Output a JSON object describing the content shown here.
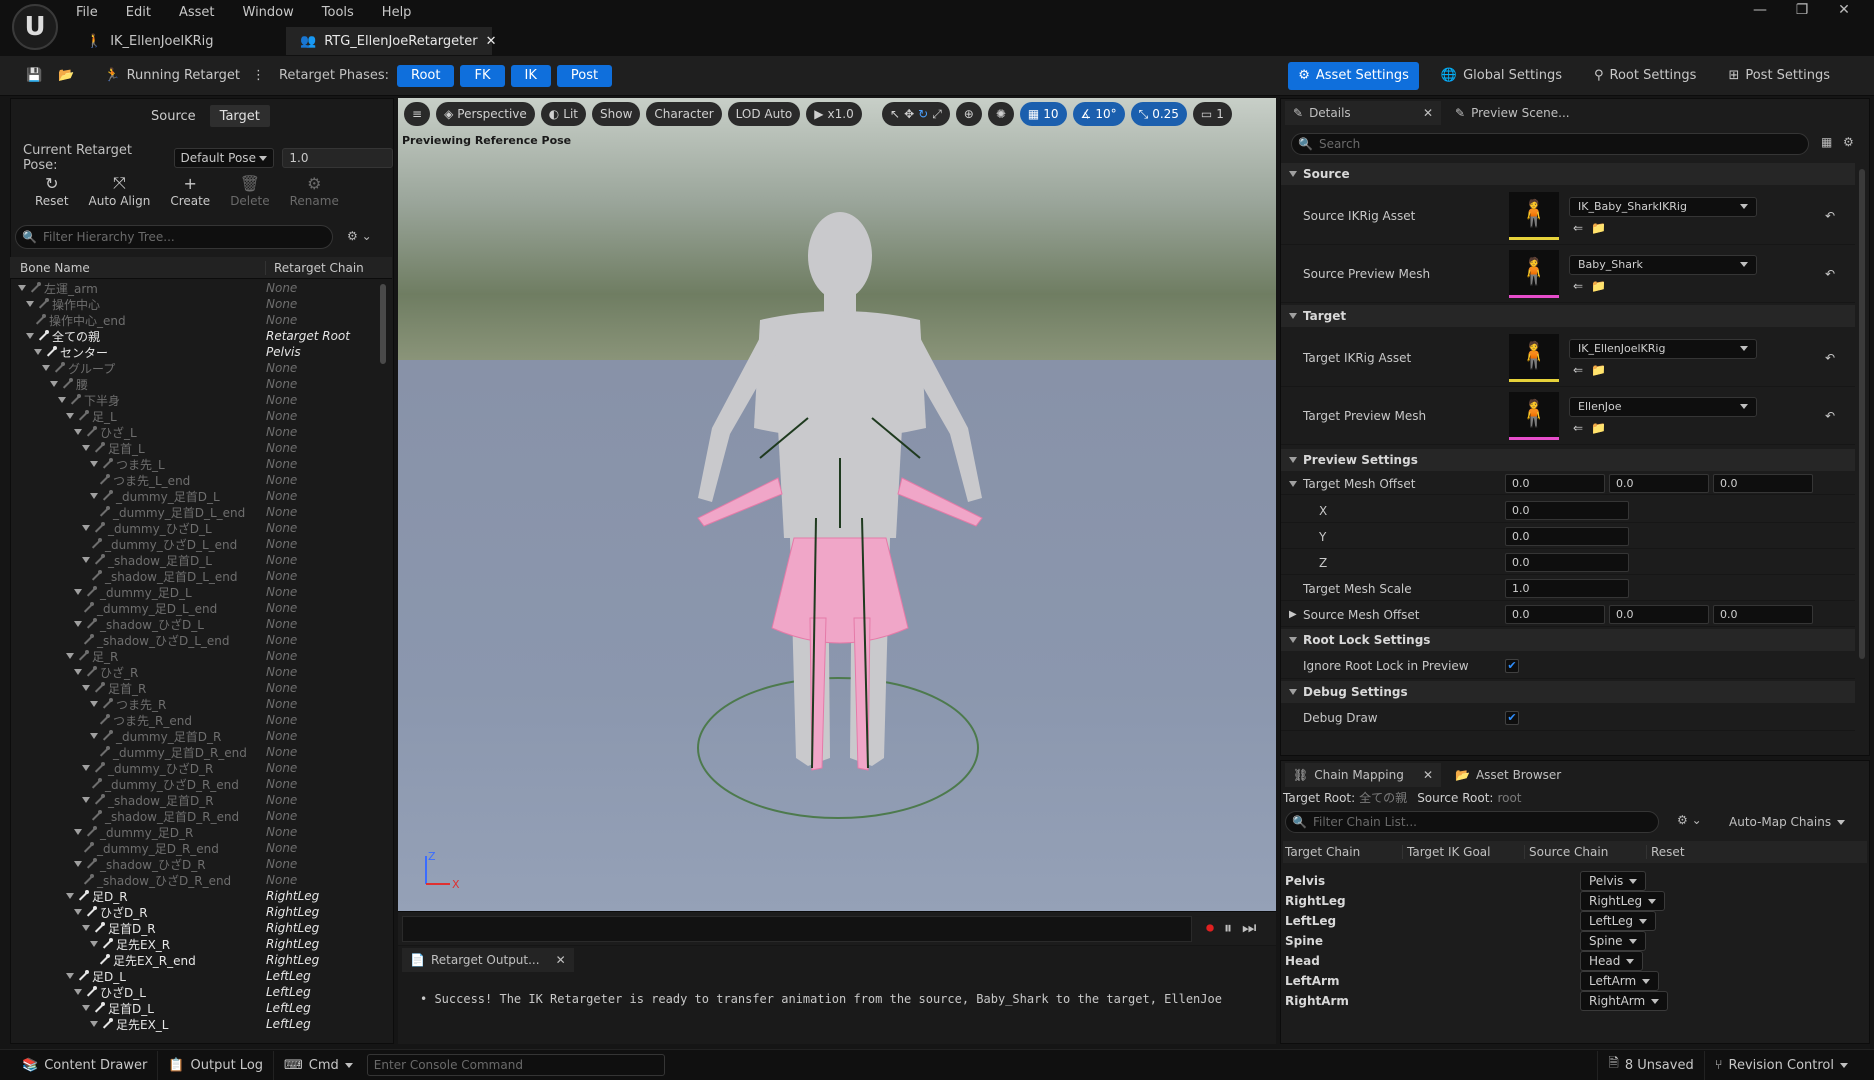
{
  "menu": [
    "File",
    "Edit",
    "Asset",
    "Window",
    "Tools",
    "Help"
  ],
  "tabs": [
    {
      "label": "IK_EllenJoelKRig"
    },
    {
      "label": "RTG_EllenJoeRetargeter"
    }
  ],
  "toolbar": {
    "running": "Running Retarget",
    "phases_label": "Retarget Phases:",
    "phases": [
      "Root",
      "FK",
      "IK",
      "Post"
    ],
    "settings": [
      "Asset Settings",
      "Global Settings",
      "Root Settings",
      "Post Settings"
    ]
  },
  "left": {
    "source": "Source",
    "target": "Target",
    "pose_label": "Current Retarget Pose:",
    "pose_value": "Default Pose",
    "pose_blend": "1.0",
    "actions": [
      "Reset",
      "Auto Align",
      "Create",
      "Delete",
      "Rename"
    ],
    "filter_placeholder": "Filter Hierarchy Tree...",
    "col_bone": "Bone Name",
    "col_chain": "Retarget Chain",
    "bones": [
      {
        "n": "左運_arm",
        "c": "None",
        "d": 0,
        "t": 1,
        "s": "dim"
      },
      {
        "n": "操作中心",
        "c": "None",
        "d": 1,
        "t": 1,
        "s": "dim"
      },
      {
        "n": "操作中心_end",
        "c": "None",
        "d": 2,
        "t": 0,
        "s": "dim"
      },
      {
        "n": "全ての親",
        "c": "Retarget Root",
        "d": 1,
        "t": 1,
        "s": "hi"
      },
      {
        "n": "センター",
        "c": "Pelvis",
        "d": 2,
        "t": 1,
        "s": "hi"
      },
      {
        "n": "グループ",
        "c": "None",
        "d": 3,
        "t": 1,
        "s": "dim"
      },
      {
        "n": "腰",
        "c": "None",
        "d": 4,
        "t": 1,
        "s": "dim"
      },
      {
        "n": "下半身",
        "c": "None",
        "d": 5,
        "t": 1,
        "s": "dim"
      },
      {
        "n": "足_L",
        "c": "None",
        "d": 6,
        "t": 1,
        "s": "dim"
      },
      {
        "n": "ひざ_L",
        "c": "None",
        "d": 7,
        "t": 1,
        "s": "dim"
      },
      {
        "n": "足首_L",
        "c": "None",
        "d": 8,
        "t": 1,
        "s": "dim"
      },
      {
        "n": "つま先_L",
        "c": "None",
        "d": 9,
        "t": 1,
        "s": "dim"
      },
      {
        "n": "つま先_L_end",
        "c": "None",
        "d": 10,
        "t": 0,
        "s": "dim"
      },
      {
        "n": "_dummy_足首D_L",
        "c": "None",
        "d": 9,
        "t": 1,
        "s": "dim"
      },
      {
        "n": "_dummy_足首D_L_end",
        "c": "None",
        "d": 10,
        "t": 0,
        "s": "dim"
      },
      {
        "n": "_dummy_ひざD_L",
        "c": "None",
        "d": 8,
        "t": 1,
        "s": "dim"
      },
      {
        "n": "_dummy_ひざD_L_end",
        "c": "None",
        "d": 9,
        "t": 0,
        "s": "dim"
      },
      {
        "n": "_shadow_足首D_L",
        "c": "None",
        "d": 8,
        "t": 1,
        "s": "dim"
      },
      {
        "n": "_shadow_足首D_L_end",
        "c": "None",
        "d": 9,
        "t": 0,
        "s": "dim"
      },
      {
        "n": "_dummy_足D_L",
        "c": "None",
        "d": 7,
        "t": 1,
        "s": "dim"
      },
      {
        "n": "_dummy_足D_L_end",
        "c": "None",
        "d": 8,
        "t": 0,
        "s": "dim"
      },
      {
        "n": "_shadow_ひざD_L",
        "c": "None",
        "d": 7,
        "t": 1,
        "s": "dim"
      },
      {
        "n": "_shadow_ひざD_L_end",
        "c": "None",
        "d": 8,
        "t": 0,
        "s": "dim"
      },
      {
        "n": "足_R",
        "c": "None",
        "d": 6,
        "t": 1,
        "s": "dim"
      },
      {
        "n": "ひざ_R",
        "c": "None",
        "d": 7,
        "t": 1,
        "s": "dim"
      },
      {
        "n": "足首_R",
        "c": "None",
        "d": 8,
        "t": 1,
        "s": "dim"
      },
      {
        "n": "つま先_R",
        "c": "None",
        "d": 9,
        "t": 1,
        "s": "dim"
      },
      {
        "n": "つま先_R_end",
        "c": "None",
        "d": 10,
        "t": 0,
        "s": "dim"
      },
      {
        "n": "_dummy_足首D_R",
        "c": "None",
        "d": 9,
        "t": 1,
        "s": "dim"
      },
      {
        "n": "_dummy_足首D_R_end",
        "c": "None",
        "d": 10,
        "t": 0,
        "s": "dim"
      },
      {
        "n": "_dummy_ひざD_R",
        "c": "None",
        "d": 8,
        "t": 1,
        "s": "dim"
      },
      {
        "n": "_dummy_ひざD_R_end",
        "c": "None",
        "d": 9,
        "t": 0,
        "s": "dim"
      },
      {
        "n": "_shadow_足首D_R",
        "c": "None",
        "d": 8,
        "t": 1,
        "s": "dim"
      },
      {
        "n": "_shadow_足首D_R_end",
        "c": "None",
        "d": 9,
        "t": 0,
        "s": "dim"
      },
      {
        "n": "_dummy_足D_R",
        "c": "None",
        "d": 7,
        "t": 1,
        "s": "dim"
      },
      {
        "n": "_dummy_足D_R_end",
        "c": "None",
        "d": 8,
        "t": 0,
        "s": "dim"
      },
      {
        "n": "_shadow_ひざD_R",
        "c": "None",
        "d": 7,
        "t": 1,
        "s": "dim"
      },
      {
        "n": "_shadow_ひざD_R_end",
        "c": "None",
        "d": 8,
        "t": 0,
        "s": "dim"
      },
      {
        "n": "足D_R",
        "c": "RightLeg",
        "d": 6,
        "t": 1,
        "s": "hi"
      },
      {
        "n": "ひざD_R",
        "c": "RightLeg",
        "d": 7,
        "t": 1,
        "s": "hi"
      },
      {
        "n": "足首D_R",
        "c": "RightLeg",
        "d": 8,
        "t": 1,
        "s": "hi"
      },
      {
        "n": "足先EX_R",
        "c": "RightLeg",
        "d": 9,
        "t": 1,
        "s": "hi"
      },
      {
        "n": "足先EX_R_end",
        "c": "RightLeg",
        "d": 10,
        "t": 0,
        "s": "hi"
      },
      {
        "n": "足D_L",
        "c": "LeftLeg",
        "d": 6,
        "t": 1,
        "s": "hi"
      },
      {
        "n": "ひざD_L",
        "c": "LeftLeg",
        "d": 7,
        "t": 1,
        "s": "hi"
      },
      {
        "n": "足首D_L",
        "c": "LeftLeg",
        "d": 8,
        "t": 1,
        "s": "hi"
      },
      {
        "n": "足先EX_L",
        "c": "LeftLeg",
        "d": 9,
        "t": 1,
        "s": "hi"
      }
    ]
  },
  "viewport": {
    "perspective": "Perspective",
    "lit": "Lit",
    "show": "Show",
    "character": "Character",
    "lod": "LOD Auto",
    "speed": "x1.0",
    "grid": "10",
    "angle": "10°",
    "scale": "0.25",
    "cam": "1",
    "preview_label": "Previewing Reference Pose",
    "axis_x": "X",
    "axis_z": "Z"
  },
  "output": {
    "tab": "Retarget Output...",
    "message": "Success! The IK Retargeter is ready to transfer animation from the source, Baby_Shark to the target, EllenJoe"
  },
  "details": {
    "tab": "Details",
    "tab2": "Preview Scene...",
    "search_placeholder": "Search",
    "sec_source": "Source",
    "source_ikrig_label": "Source IKRig Asset",
    "source_ikrig": "IK_Baby_SharkIKRig",
    "source_mesh_label": "Source Preview Mesh",
    "source_mesh": "Baby_Shark",
    "sec_target": "Target",
    "target_ikrig_label": "Target IKRig Asset",
    "target_ikrig": "IK_EllenJoelKRig",
    "target_mesh_label": "Target Preview Mesh",
    "target_mesh": "EllenJoe",
    "sec_preview": "Preview Settings",
    "offset_label": "Target Mesh Offset",
    "offset": [
      "0.0",
      "0.0",
      "0.0"
    ],
    "x": "X",
    "y": "Y",
    "z": "Z",
    "xv": "0.0",
    "yv": "0.0",
    "zv": "0.0",
    "scale_label": "Target Mesh Scale",
    "scale": "1.0",
    "src_offset_label": "Source Mesh Offset",
    "src_offset": [
      "0.0",
      "0.0",
      "0.0"
    ],
    "sec_rootlock": "Root Lock Settings",
    "rootlock_label": "Ignore Root Lock in Preview",
    "sec_debug": "Debug Settings",
    "debug_label": "Debug Draw"
  },
  "chain": {
    "tab": "Chain Mapping",
    "tab2": "Asset Browser",
    "target_root_label": "Target Root:",
    "target_root": "全ての親",
    "source_root_label": "Source Root:",
    "source_root": "root",
    "filter_placeholder": "Filter Chain List...",
    "automap": "Auto-Map Chains",
    "cols": [
      "Target Chain",
      "Target IK Goal",
      "Source Chain",
      "Reset"
    ],
    "rows": [
      {
        "t": "Pelvis",
        "s": "Pelvis"
      },
      {
        "t": "RightLeg",
        "s": "RightLeg"
      },
      {
        "t": "LeftLeg",
        "s": "LeftLeg"
      },
      {
        "t": "Spine",
        "s": "Spine"
      },
      {
        "t": "Head",
        "s": "Head"
      },
      {
        "t": "LeftArm",
        "s": "LeftArm"
      },
      {
        "t": "RightArm",
        "s": "RightArm"
      }
    ]
  },
  "status": {
    "content": "Content Drawer",
    "output": "Output Log",
    "cmd": "Cmd",
    "console_placeholder": "Enter Console Command",
    "unsaved": "8 Unsaved",
    "revision": "Revision Control"
  }
}
